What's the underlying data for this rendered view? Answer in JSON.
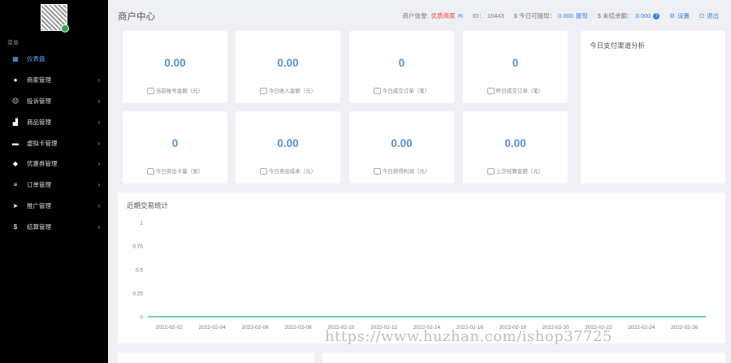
{
  "sidebar": {
    "section_label": "菜单",
    "items": [
      {
        "label": "仪表盘",
        "icon": "dashboard-icon",
        "glyph": "▦",
        "active": true,
        "has_children": false
      },
      {
        "label": "商家管理",
        "icon": "user-icon",
        "glyph": "●",
        "active": false,
        "has_children": true
      },
      {
        "label": "投诉管理",
        "icon": "complaint-icon",
        "glyph": "☹",
        "active": false,
        "has_children": true
      },
      {
        "label": "商品管理",
        "icon": "shopping-bag-icon",
        "glyph": "▟",
        "active": false,
        "has_children": true
      },
      {
        "label": "虚拟卡管理",
        "icon": "card-icon",
        "glyph": "▬",
        "active": false,
        "has_children": true
      },
      {
        "label": "优惠券管理",
        "icon": "tag-icon",
        "glyph": "◆",
        "active": false,
        "has_children": true
      },
      {
        "label": "订单管理",
        "icon": "list-icon",
        "glyph": "≡",
        "active": false,
        "has_children": true
      },
      {
        "label": "推广管理",
        "icon": "send-icon",
        "glyph": "➤",
        "active": false,
        "has_children": true
      },
      {
        "label": "结算管理",
        "icon": "dollar-icon",
        "glyph": "$",
        "active": false,
        "has_children": true
      }
    ]
  },
  "header": {
    "title": "商户中心",
    "merchant_label": "商户信誉:",
    "merchant_value": "优质商家",
    "id_label": "ID：",
    "id_value": "10443",
    "withdrawable_label": "$ 今日可提现：",
    "withdrawable_value": "0.000",
    "withdraw_link": "提现",
    "unsettled_label": "$ 未结余额：",
    "unsettled_value": "0.000",
    "help_glyph": "?",
    "settings_label": "设置",
    "logout_label": "退出"
  },
  "stats": [
    {
      "value": "0.00",
      "label": "当前账号金额（元）",
      "icon": "wallet-icon"
    },
    {
      "value": "0.00",
      "label": "今日收入金额（元）",
      "icon": "income-icon"
    },
    {
      "value": "0",
      "label": "今日成交订单（笔）",
      "icon": "order-icon"
    },
    {
      "value": "0",
      "label": "昨日成交订单（笔）",
      "icon": "calendar-icon"
    },
    {
      "value": "0",
      "label": "今日卖出卡量（张）",
      "icon": "card-icon"
    },
    {
      "value": "0.00",
      "label": "今日卖出成本（元）",
      "icon": "coins-icon"
    },
    {
      "value": "0.00",
      "label": "今日获得利润（元）",
      "icon": "profit-icon"
    },
    {
      "value": "0.00",
      "label": "上次结算金额（元）",
      "icon": "settle-icon"
    }
  ],
  "analysis": {
    "title": "今日支付渠道分析"
  },
  "chart_data": {
    "type": "line",
    "title": "近期交易统计",
    "x": [
      "2022-02-01",
      "2022-02-02",
      "2022-02-03",
      "2022-02-04",
      "2022-02-05",
      "2022-02-06",
      "2022-02-07",
      "2022-02-08",
      "2022-02-09",
      "2022-02-10",
      "2022-02-11",
      "2022-02-12",
      "2022-02-13",
      "2022-02-14",
      "2022-02-15",
      "2022-02-16",
      "2022-02-17",
      "2022-02-18",
      "2022-02-19",
      "2022-02-20",
      "2022-02-21",
      "2022-02-22",
      "2022-02-23",
      "2022-02-24",
      "2022-02-25",
      "2022-02-26",
      "2022-02-27"
    ],
    "xtick_labels": [
      "2022-02-02",
      "2022-02-04",
      "2022-02-06",
      "2022-02-08",
      "2022-02-10",
      "2022-02-12",
      "2022-02-14",
      "2022-02-16",
      "2022-02-18",
      "2022-02-20",
      "2022-02-22",
      "2022-02-24",
      "2022-02-26"
    ],
    "series": [
      {
        "values": [
          0,
          0,
          0,
          0,
          0,
          0,
          0,
          0,
          0,
          0,
          0,
          0,
          0,
          0,
          0,
          0,
          0,
          0,
          0,
          0,
          0,
          0,
          0,
          0,
          0,
          0,
          0
        ],
        "color": "#3cc08a"
      }
    ],
    "yticks": [
      "0",
      "0.25",
      "0.5",
      "0.75",
      "1"
    ],
    "ylim": [
      0,
      1
    ],
    "grid": false
  },
  "watermark": "https://www.huzhan.com/ishop37725",
  "colors": {
    "accent": "#3a7ee6",
    "value": "#5b8fd0",
    "line": "#3cc08a",
    "warn": "#e44"
  }
}
